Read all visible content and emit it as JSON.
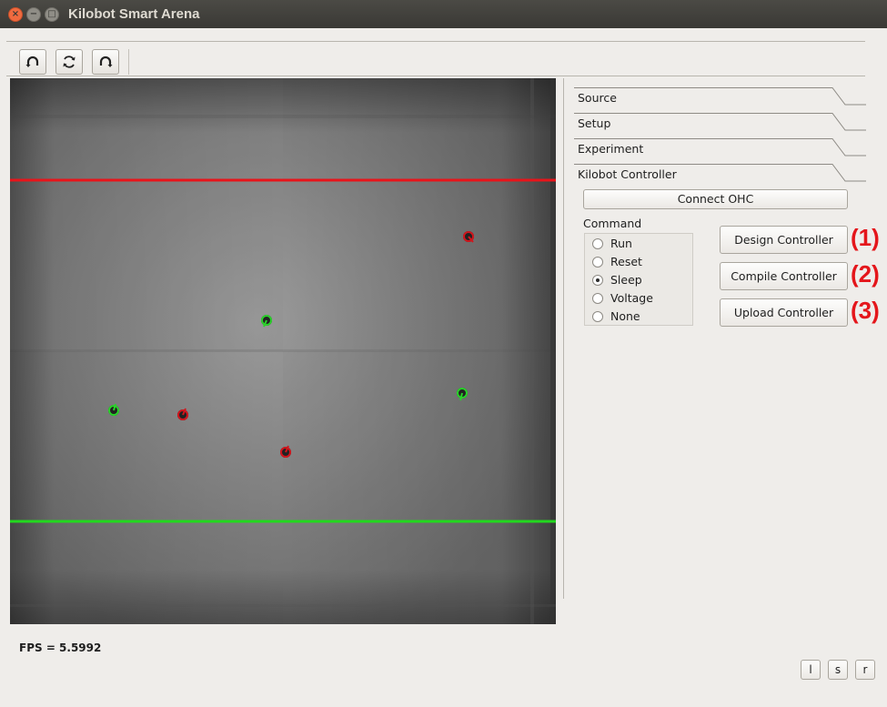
{
  "window": {
    "title": "Kilobot Smart Arena",
    "close_glyph": "×",
    "min_glyph": "−",
    "max_glyph": "□"
  },
  "toolbar": {
    "icons": [
      "rotate-ccw-icon",
      "refresh-icon",
      "rotate-cw-icon"
    ]
  },
  "colors": {
    "top_line": "#e8141a",
    "bottom_line": "#22d81e",
    "red_bot": "#d2151c",
    "green_bot": "#2ad22a",
    "number_red": "#e4161b"
  },
  "tabs": [
    {
      "label": "Source"
    },
    {
      "label": "Setup"
    },
    {
      "label": "Experiment"
    },
    {
      "label": "Kilobot Controller"
    }
  ],
  "controller": {
    "connect_label": "Connect OHC",
    "command_title": "Command",
    "commands": [
      "Run",
      "Reset",
      "Sleep",
      "Voltage",
      "None"
    ],
    "selected_command": "Sleep",
    "design_label": "Design Controller",
    "compile_label": "Compile Controller",
    "upload_label": "Upload Controller",
    "step_numbers": [
      "(1)",
      "(2)",
      "(3)"
    ]
  },
  "status": {
    "fps_text": "FPS = 5.5992"
  },
  "bottom_buttons": [
    "l",
    "s",
    "r"
  ]
}
